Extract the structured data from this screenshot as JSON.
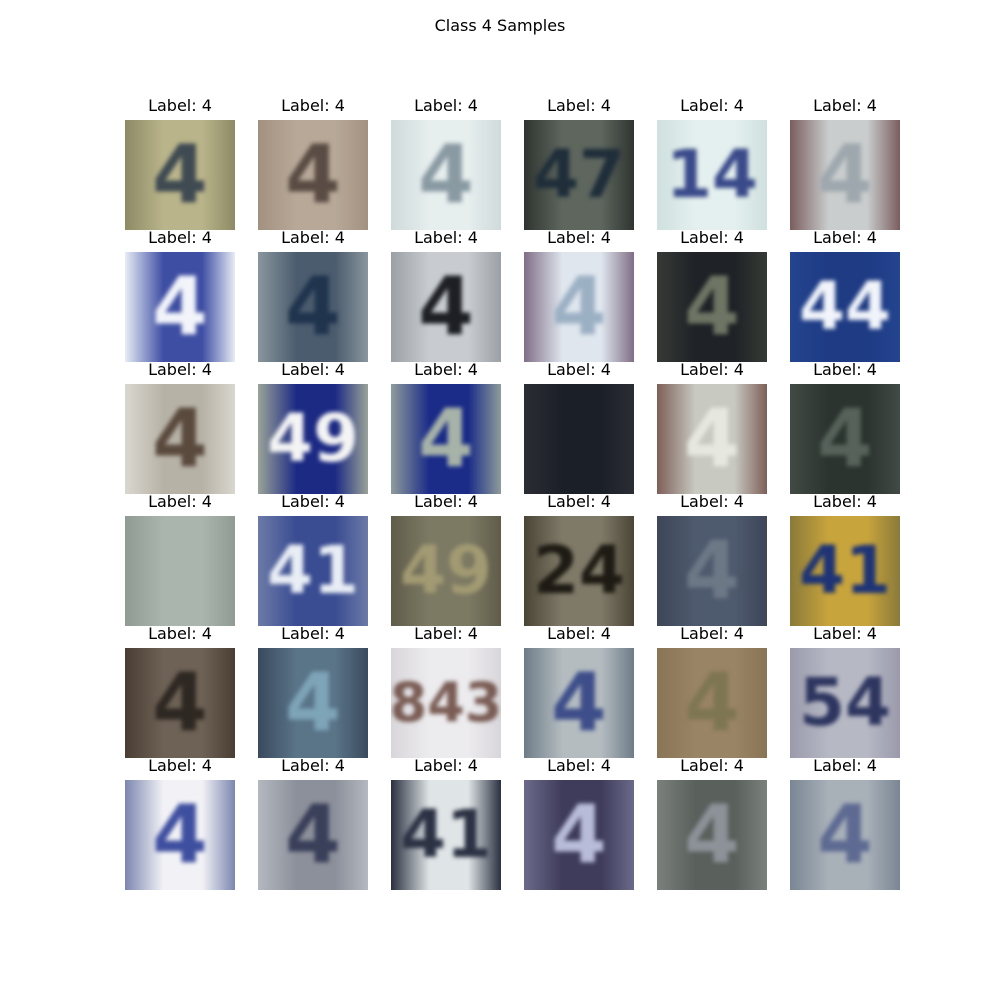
{
  "figure": {
    "title": "Class 4 Samples"
  },
  "samples": [
    {
      "label": "Label: 4",
      "glyph": "4",
      "bg": "#b9b48a",
      "bg2": "#8d8a66",
      "fg": "#3f4a52"
    },
    {
      "label": "Label: 4",
      "glyph": "4",
      "bg": "#b8a898",
      "bg2": "#a39180",
      "fg": "#5a4c44"
    },
    {
      "label": "Label: 4",
      "glyph": "4",
      "bg": "#e6eeee",
      "bg2": "#cfdada",
      "fg": "#8a9aa3"
    },
    {
      "label": "Label: 4",
      "glyph": "47",
      "bg": "#5e665e",
      "bg2": "#2f3430",
      "fg": "#1f2e3a"
    },
    {
      "label": "Label: 4",
      "glyph": "14",
      "bg": "#e4f0ef",
      "bg2": "#cfe0de",
      "fg": "#3a4a8a"
    },
    {
      "label": "Label: 4",
      "glyph": "4",
      "bg": "#c9cdcd",
      "bg2": "#7b5d5e",
      "fg": "#9da7ad"
    },
    {
      "label": "Label: 4",
      "glyph": "4",
      "bg": "#3e4ea3",
      "bg2": "#e7ecf5",
      "fg": "#f2f4fa"
    },
    {
      "label": "Label: 4",
      "glyph": "4",
      "bg": "#4b5c6e",
      "bg2": "#8a969e",
      "fg": "#20344e"
    },
    {
      "label": "Label: 4",
      "glyph": "4",
      "bg": "#c8ccd0",
      "bg2": "#9ba0a6",
      "fg": "#1d1f24"
    },
    {
      "label": "Label: 4",
      "glyph": "4",
      "bg": "#dfe6ee",
      "bg2": "#806e86",
      "fg": "#9cb0c4"
    },
    {
      "label": "Label: 4",
      "glyph": "4",
      "bg": "#1f2226",
      "bg2": "#363a36",
      "fg": "#6f7564"
    },
    {
      "label": "Label: 4",
      "glyph": "44",
      "bg": "#1e3b84",
      "bg2": "#24448f",
      "fg": "#f1f4fa"
    },
    {
      "label": "Label: 4",
      "glyph": "4",
      "bg": "#b7b2a6",
      "bg2": "#d9d7cf",
      "fg": "#5a4a3e"
    },
    {
      "label": "Label: 4",
      "glyph": "49",
      "bg": "#1c2a84",
      "bg2": "#9aa398",
      "fg": "#f4f4f4"
    },
    {
      "label": "Label: 4",
      "glyph": "4",
      "bg": "#1a2b88",
      "bg2": "#8f9c9b",
      "fg": "#a7b3a8"
    },
    {
      "label": "Label: 4",
      "glyph": "",
      "bg": "#1b1f28",
      "bg2": "#2a2d33",
      "fg": "#2a2d33"
    },
    {
      "label": "Label: 4",
      "glyph": "4",
      "bg": "#c8cac2",
      "bg2": "#7d5f58",
      "fg": "#e6e8e0"
    },
    {
      "label": "Label: 4",
      "glyph": "4",
      "bg": "#2b342f",
      "bg2": "#414a44",
      "fg": "#56625a"
    },
    {
      "label": "Label: 4",
      "glyph": "",
      "bg": "#aab6ad",
      "bg2": "#8f9b93",
      "fg": "#9eaaa2"
    },
    {
      "label": "Label: 4",
      "glyph": "41",
      "bg": "#3a4c92",
      "bg2": "#6c7aa8",
      "fg": "#e9eef5"
    },
    {
      "label": "Label: 4",
      "glyph": "49",
      "bg": "#7d7a64",
      "bg2": "#5f5c4a",
      "fg": "#a29a72"
    },
    {
      "label": "Label: 4",
      "glyph": "24",
      "bg": "#7f7a68",
      "bg2": "#4a4536",
      "fg": "#1e1b14"
    },
    {
      "label": "Label: 4",
      "glyph": "4",
      "bg": "#4e5a6e",
      "bg2": "#3e4658",
      "fg": "#6d7886"
    },
    {
      "label": "Label: 4",
      "glyph": "41",
      "bg": "#c8a43c",
      "bg2": "#8a7a3a",
      "fg": "#1e3476"
    },
    {
      "label": "Label: 4",
      "glyph": "4",
      "bg": "#6e6256",
      "bg2": "#4a3e34",
      "fg": "#2e2822"
    },
    {
      "label": "Label: 4",
      "glyph": "4",
      "bg": "#5a7488",
      "bg2": "#3a4a5e",
      "fg": "#7ea4b8"
    },
    {
      "label": "Label: 4",
      "glyph": "843",
      "bg": "#ecebee",
      "bg2": "#d8d6da",
      "fg": "#7a5c54"
    },
    {
      "label": "Label: 4",
      "glyph": "4",
      "bg": "#b4bcc0",
      "bg2": "#6e7c88",
      "fg": "#3e4e8a"
    },
    {
      "label": "Label: 4",
      "glyph": "4",
      "bg": "#9a8466",
      "bg2": "#8a7456",
      "fg": "#7e7652"
    },
    {
      "label": "Label: 4",
      "glyph": "54",
      "bg": "#b6b8c4",
      "bg2": "#9a9aac",
      "fg": "#2e3660"
    },
    {
      "label": "Label: 4",
      "glyph": "4",
      "bg": "#f2f2f6",
      "bg2": "#7c86b0",
      "fg": "#3f4fa0"
    },
    {
      "label": "Label: 4",
      "glyph": "4",
      "bg": "#8c909a",
      "bg2": "#b4b8c0",
      "fg": "#3a3f5a"
    },
    {
      "label": "Label: 4",
      "glyph": "41",
      "bg": "#dfe4e6",
      "bg2": "#2a3040",
      "fg": "#2c3244"
    },
    {
      "label": "Label: 4",
      "glyph": "4",
      "bg": "#3e3c5a",
      "bg2": "#6c6a8a",
      "fg": "#b8bcd8"
    },
    {
      "label": "Label: 4",
      "glyph": "4",
      "bg": "#5a605c",
      "bg2": "#7a807c",
      "fg": "#8c9298"
    },
    {
      "label": "Label: 4",
      "glyph": "4",
      "bg": "#a8b0b8",
      "bg2": "#7a8694",
      "fg": "#5e6a92"
    }
  ]
}
